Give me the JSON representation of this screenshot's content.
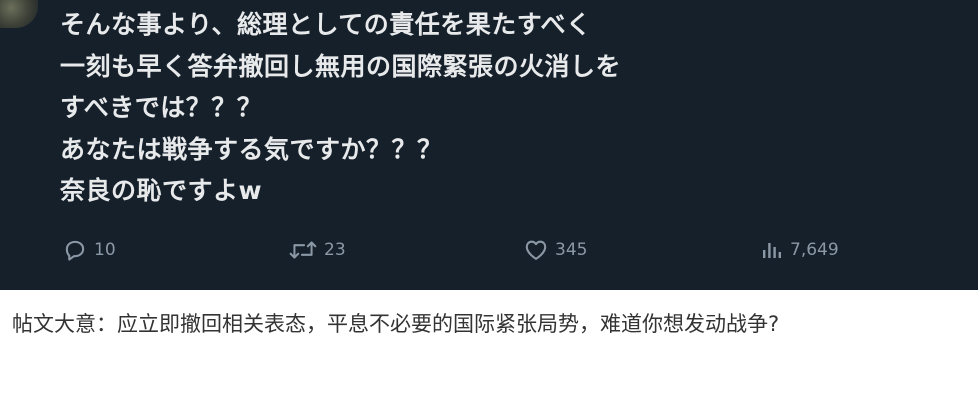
{
  "tweet": {
    "lines": [
      "そんな事より、総理としての責任を果たすべく",
      "一刻も早く答弁撤回し無用の国際緊張の火消しを",
      "すべきでは？？？",
      "あなたは戦争する気ですか？？？",
      "奈良の恥ですよw"
    ],
    "actions": {
      "reply_count": "10",
      "repost_count": "23",
      "like_count": "345",
      "views_count": "7,649"
    },
    "icons": {
      "reply": "reply-icon",
      "repost": "repost-icon",
      "like": "like-icon",
      "views": "views-icon"
    },
    "colors": {
      "background": "#15202b",
      "text": "#e7e9ea",
      "muted": "#8b98a5"
    }
  },
  "caption": {
    "text": "帖文大意：应立即撤回相关表态，平息不必要的国际紧张局势，难道你想发动战争?"
  }
}
